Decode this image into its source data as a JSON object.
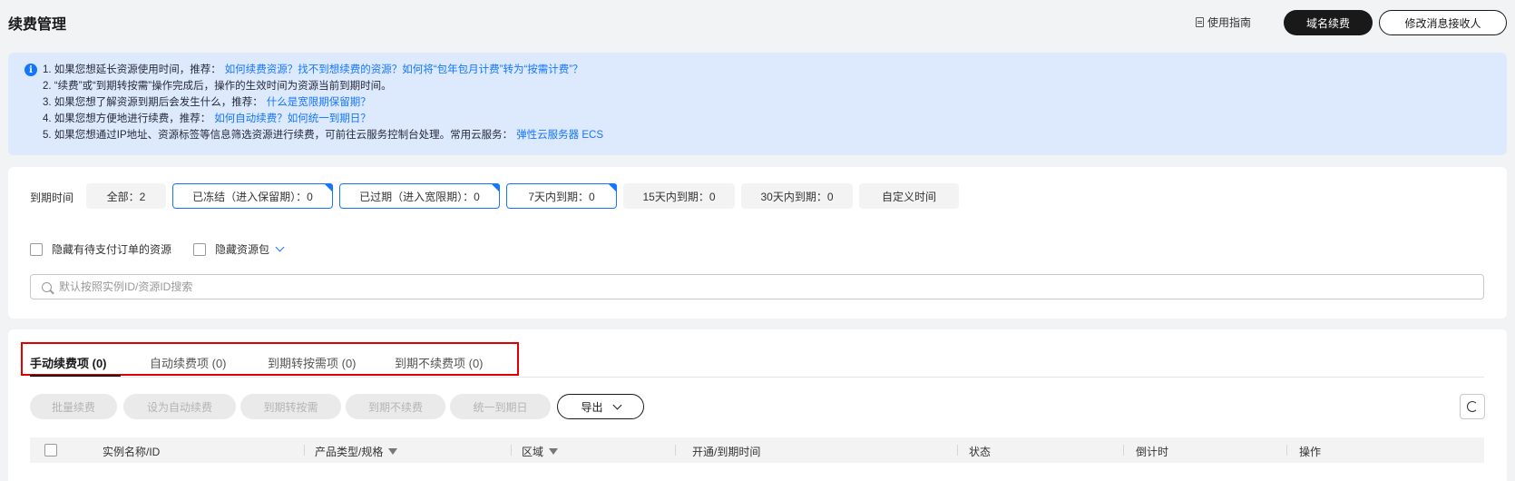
{
  "header": {
    "title": "续费管理",
    "guide_link": "使用指南",
    "domain_renew_button": "域名续费",
    "modify_receiver_button": "修改消息接收人"
  },
  "notice": {
    "lines": [
      {
        "text": "1. 如果您想延长资源使用时间，推荐：",
        "link": "如何续费资源？找不到想续费的资源？如何将“包年包月计费”转为“按需计费”？"
      },
      {
        "text": "2. “续费”或“到期转按需”操作完成后，操作的生效时间为资源当前到期时间。",
        "link": ""
      },
      {
        "text": "3. 如果您想了解资源到期后会发生什么，推荐：",
        "link": "什么是宽限期保留期？"
      },
      {
        "text": "4. 如果您想方便地进行续费，推荐：",
        "link": "如何自动续费？如何统一到期日？"
      },
      {
        "text": "5. 如果您想通过IP地址、资源标签等信息筛选资源进行续费，可前往云服务控制台处理。常用云服务：",
        "link": "弹性云服务器 ECS"
      }
    ]
  },
  "filters": {
    "expire_label": "到期时间",
    "chips": [
      "全部：2",
      "已冻结（进入保留期）：0",
      "已过期（进入宽限期）：0",
      "7天内到期：0",
      "15天内到期：0",
      "30天内到期：0",
      "自定义时间"
    ],
    "hide_pending_label": "隐藏有待支付订单的资源",
    "hide_package_label": "隐藏资源包",
    "search_placeholder": "默认按照实例ID/资源ID搜索"
  },
  "tabs": [
    "手动续费项 (0)",
    "自动续费项 (0)",
    "到期转按需项 (0)",
    "到期不续费项 (0)"
  ],
  "actions": {
    "batch_renew": "批量续费",
    "set_auto_renew": "设为自动续费",
    "to_on_demand": "到期转按需",
    "no_renew": "到期不续费",
    "unify_date": "统一到期日",
    "export": "导出"
  },
  "table": {
    "columns": [
      "实例名称/ID",
      "产品类型/规格",
      "区域",
      "开通/到期时间",
      "状态",
      "倒计时",
      "操作"
    ]
  },
  "colors": {
    "accent": "#1476ff",
    "notice_bg": "#dde9fd",
    "highlight": "#e00000",
    "primary_button": "#191919"
  }
}
